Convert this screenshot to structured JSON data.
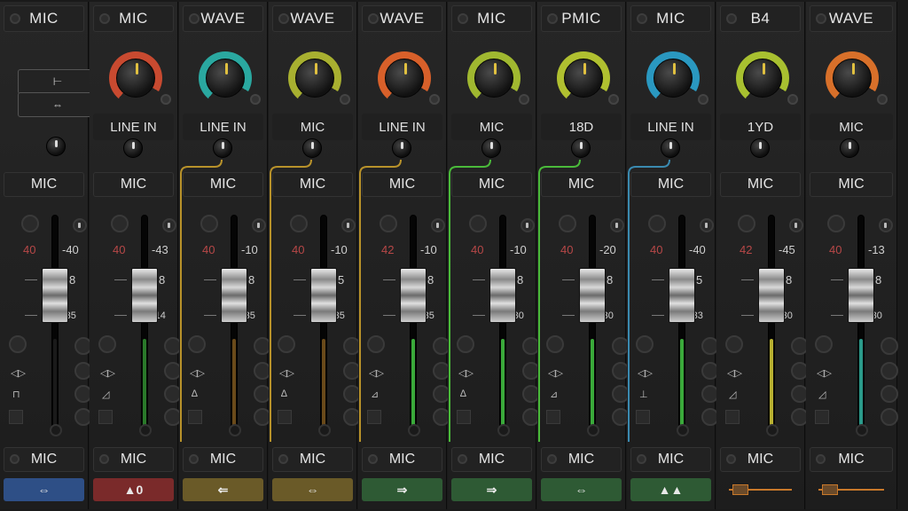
{
  "strips": [
    {
      "top": "MIC",
      "source": "",
      "route": "MIC",
      "scale": {
        "a": "-40",
        "b": "8",
        "c": "-35",
        "red": "40"
      },
      "foot": "MIC",
      "button_label": "⇔",
      "button_color": "#2e4f86",
      "ring_color": "#555",
      "knob_ptr": "#ccc",
      "has_knob": false,
      "meter_color": "#1a1a1a",
      "link_color": ""
    },
    {
      "top": "MIC",
      "source": "LINE IN",
      "route": "MIC",
      "scale": {
        "a": "-43",
        "b": "8",
        "c": "-14",
        "red": "40"
      },
      "foot": "MIC",
      "button_label": "▲0",
      "button_color": "#7a2a2a",
      "ring_color": "#c84a30",
      "knob_ptr": "#e0c040",
      "has_knob": true,
      "meter_color": "#2a7a2a",
      "link_color": ""
    },
    {
      "top": "WAVE",
      "source": "LINE IN",
      "route": "MIC",
      "scale": {
        "a": "-10",
        "b": "8",
        "c": "-35",
        "red": "40"
      },
      "foot": "MIC",
      "button_label": "⇐",
      "button_color": "#6a5a28",
      "ring_color": "#2aa8a0",
      "knob_ptr": "#e0c040",
      "has_knob": true,
      "meter_color": "#6a4a1a",
      "link_color": "#b8922a"
    },
    {
      "top": "WAVE",
      "source": "MIC",
      "route": "MIC",
      "scale": {
        "a": "-10",
        "b": "5",
        "c": "-35",
        "red": "40"
      },
      "foot": "MIC",
      "button_label": "⇔",
      "button_color": "#6a5a28",
      "ring_color": "#a8b030",
      "knob_ptr": "#e0c040",
      "has_knob": true,
      "meter_color": "#6a4a1a",
      "link_color": "#b8922a"
    },
    {
      "top": "WAVE",
      "source": "LINE IN",
      "route": "MIC",
      "scale": {
        "a": "-10",
        "b": "8",
        "c": "-35",
        "red": "42"
      },
      "foot": "MIC",
      "button_label": "⇒",
      "button_color": "#2e5a34",
      "ring_color": "#d8602a",
      "knob_ptr": "#e0c040",
      "has_knob": true,
      "meter_color": "#3aaa3a",
      "link_color": "#b8922a"
    },
    {
      "top": "MIC",
      "source": "MIC",
      "route": "MIC",
      "scale": {
        "a": "-10",
        "b": "8",
        "c": "-30",
        "red": "40"
      },
      "foot": "MIC",
      "button_label": "⇒",
      "button_color": "#2e5a34",
      "ring_color": "#a0b830",
      "knob_ptr": "#e0c040",
      "has_knob": true,
      "meter_color": "#3aaa3a",
      "link_color": "#4aba3a"
    },
    {
      "top": "PMIC",
      "source": "18D",
      "route": "MIC",
      "scale": {
        "a": "-20",
        "b": "8",
        "c": "-30",
        "red": "40"
      },
      "foot": "MIC",
      "button_label": "⇔",
      "button_color": "#2e5a34",
      "ring_color": "#b0c030",
      "knob_ptr": "#e0c040",
      "has_knob": true,
      "meter_color": "#3aaa3a",
      "link_color": "#4aba3a"
    },
    {
      "top": "MIC",
      "source": "LINE IN",
      "route": "MIC",
      "scale": {
        "a": "-40",
        "b": "5",
        "c": "-33",
        "red": "40"
      },
      "foot": "MIC",
      "button_label": "▲▲",
      "button_color": "#2e5a34",
      "ring_color": "#2a98c0",
      "knob_ptr": "#e0c040",
      "has_knob": true,
      "meter_color": "#3aaa3a",
      "link_color": "#3a8ab0"
    },
    {
      "top": "B4",
      "source": "1YD",
      "route": "MIC",
      "scale": {
        "a": "-45",
        "b": "8",
        "c": "-30",
        "red": "42"
      },
      "foot": "MIC",
      "button_label": "",
      "button_color": "",
      "ring_color": "#a8c030",
      "knob_ptr": "#e0c040",
      "has_knob": true,
      "meter_color": "#b8b030",
      "link_color": ""
    },
    {
      "top": "WAVE",
      "source": "MIC",
      "route": "MIC",
      "scale": {
        "a": "-13",
        "b": "8",
        "c": "-30",
        "red": "40"
      },
      "foot": "MIC",
      "button_label": "",
      "button_color": "",
      "ring_color": "#d8702a",
      "knob_ptr": "#e0c040",
      "has_knob": true,
      "meter_color": "#2a9a8a",
      "link_color": ""
    }
  ],
  "first_strip_buttons": [
    "⊢",
    "⇔"
  ],
  "fx_symbol": "◁▷",
  "bus_symbols": [
    "⊓",
    "◿",
    "∆",
    "∆",
    "⊿",
    "∆",
    "⊿",
    "⊥",
    "◿",
    "◿"
  ]
}
